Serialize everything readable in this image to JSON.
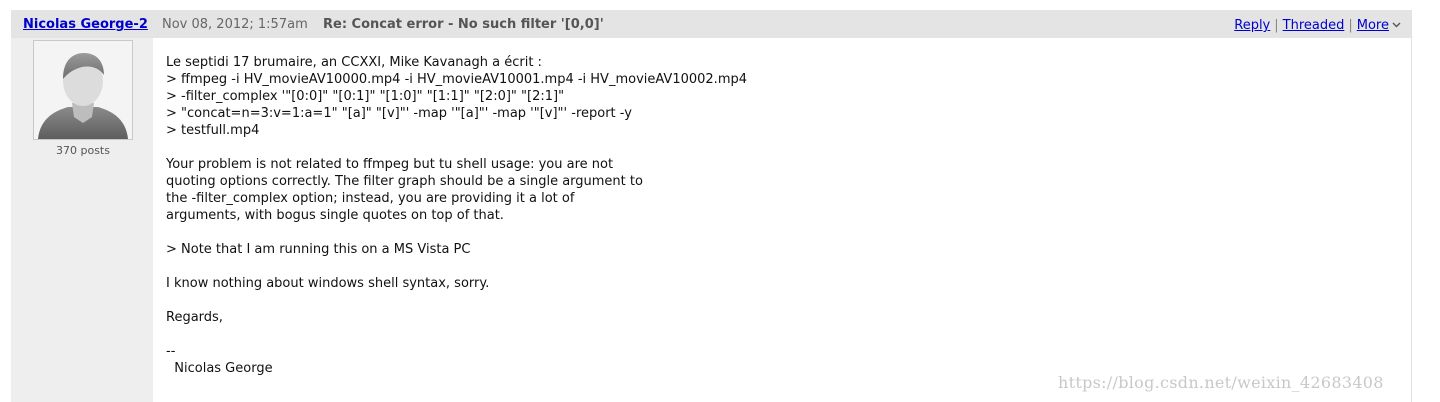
{
  "post": {
    "author": "Nicolas George-2",
    "date": "Nov 08, 2012; 1:57am",
    "subject": "Re: Concat error - No such filter '[0,0]'",
    "post_count": "370 posts",
    "actions": {
      "reply": "Reply",
      "threaded": "Threaded",
      "more": "More"
    },
    "icons": {
      "avatar": "user-silhouette-icon",
      "more": "chevron-down-icon"
    }
  },
  "message": {
    "lines": [
      "Le septidi 17 brumaire, an CCXXI, Mike Kavanagh a écrit :",
      "> ffmpeg -i HV_movieAV10000.mp4 -i HV_movieAV10001.mp4 -i HV_movieAV10002.mp4",
      "> -filter_complex '\"[0:0]\" \"[0:1]\" \"[1:0]\" \"[1:1]\" \"[2:0]\" \"[2:1]\"",
      "> \"concat=n=3:v=1:a=1\" \"[a]\" \"[v]\"' -map '\"[a]\"' -map '\"[v]\"' -report -y",
      "> testfull.mp4",
      "",
      "Your problem is not related to ffmpeg but tu shell usage: you are not",
      "quoting options correctly. The filter graph should be a single argument to",
      "the -filter_complex option; instead, you are providing it a lot of",
      "arguments, with bogus single quotes on top of that.",
      "",
      "> Note that I am running this on a MS Vista PC",
      "",
      "I know nothing about windows shell syntax, sorry.",
      "",
      "Regards,",
      "",
      "--",
      "  Nicolas George"
    ]
  },
  "watermark": "https://blog.csdn.net/weixin_42683408"
}
